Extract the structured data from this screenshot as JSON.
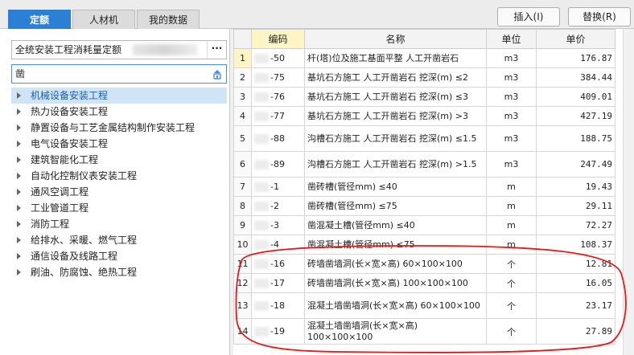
{
  "tabs": [
    {
      "label": "定额",
      "active": true
    },
    {
      "label": "人材机",
      "active": false
    },
    {
      "label": "我的数据",
      "active": false
    }
  ],
  "actions": {
    "insert_label": "插入(I)",
    "replace_label": "替换(R)"
  },
  "library": {
    "selected": "全统安装工程消耗量定额",
    "more_label": "···"
  },
  "search": {
    "value": "凿"
  },
  "tree": [
    {
      "label": "机械设备安装工程",
      "selected": true
    },
    {
      "label": "热力设备安装工程",
      "selected": false
    },
    {
      "label": "静置设备与工艺金属结构制作安装工程",
      "selected": false
    },
    {
      "label": "电气设备安装工程",
      "selected": false
    },
    {
      "label": "建筑智能化工程",
      "selected": false
    },
    {
      "label": "自动化控制仪表安装工程",
      "selected": false
    },
    {
      "label": "通风空调工程",
      "selected": false
    },
    {
      "label": "工业管道工程",
      "selected": false
    },
    {
      "label": "消防工程",
      "selected": false
    },
    {
      "label": "给排水、采暖、燃气工程",
      "selected": false
    },
    {
      "label": "通信设备及线路工程",
      "selected": false
    },
    {
      "label": "刷油、防腐蚀、绝热工程",
      "selected": false
    }
  ],
  "table": {
    "headers": {
      "code": "编码",
      "name": "名称",
      "unit": "单位",
      "price": "单价"
    },
    "rows": [
      {
        "no": "1",
        "code": "-50",
        "name": "杆(塔)位及施工基面平整 人工开凿岩石",
        "unit": "m3",
        "price": "176.87"
      },
      {
        "no": "2",
        "code": "-75",
        "name": "基坑石方施工 人工开凿岩石 挖深(m) ≤2",
        "unit": "m3",
        "price": "384.44"
      },
      {
        "no": "3",
        "code": "-76",
        "name": "基坑石方施工 人工开凿岩石 挖深(m) ≤3",
        "unit": "m3",
        "price": "409.01"
      },
      {
        "no": "4",
        "code": "-77",
        "name": "基坑石方施工 人工开凿岩石 挖深(m) >3",
        "unit": "m3",
        "price": "427.19"
      },
      {
        "no": "5",
        "code": "-88",
        "name": "沟槽石方施工 人工开凿岩石 挖深(m) ≤1.5",
        "unit": "m3",
        "price": "188.75"
      },
      {
        "no": "6",
        "code": "-89",
        "name": "沟槽石方施工 人工开凿岩石 挖深(m) >1.5",
        "unit": "m3",
        "price": "247.49"
      },
      {
        "no": "7",
        "code": "-1",
        "name": "凿砖槽(管径mm) ≤40",
        "unit": "m",
        "price": "19.43"
      },
      {
        "no": "8",
        "code": "-2",
        "name": "凿砖槽(管径mm) ≤75",
        "unit": "m",
        "price": "29.11"
      },
      {
        "no": "9",
        "code": "-3",
        "name": "凿混凝土槽(管径mm) ≤40",
        "unit": "m",
        "price": "72.27"
      },
      {
        "no": "10",
        "code": "-4",
        "name": "凿混凝土槽(管径mm) ≤75",
        "unit": "m",
        "price": "108.37"
      },
      {
        "no": "11",
        "code": "-16",
        "name": "砖墙凿墙洞(长×宽×高) 60×100×100",
        "unit": "个",
        "price": "12.81"
      },
      {
        "no": "12",
        "code": "-17",
        "name": "砖墙凿墙洞(长×宽×高) 100×100×100",
        "unit": "个",
        "price": "16.05"
      },
      {
        "no": "13",
        "code": "-18",
        "name": "混凝土墙凿墙洞(长×宽×高) 60×100×100",
        "unit": "个",
        "price": "23.17"
      },
      {
        "no": "14",
        "code": "-19",
        "name": "混凝土墙凿墙洞(长×宽×高) 100×100×100",
        "unit": "个",
        "price": "27.89"
      }
    ]
  },
  "annotation_color": "#e01b1b"
}
